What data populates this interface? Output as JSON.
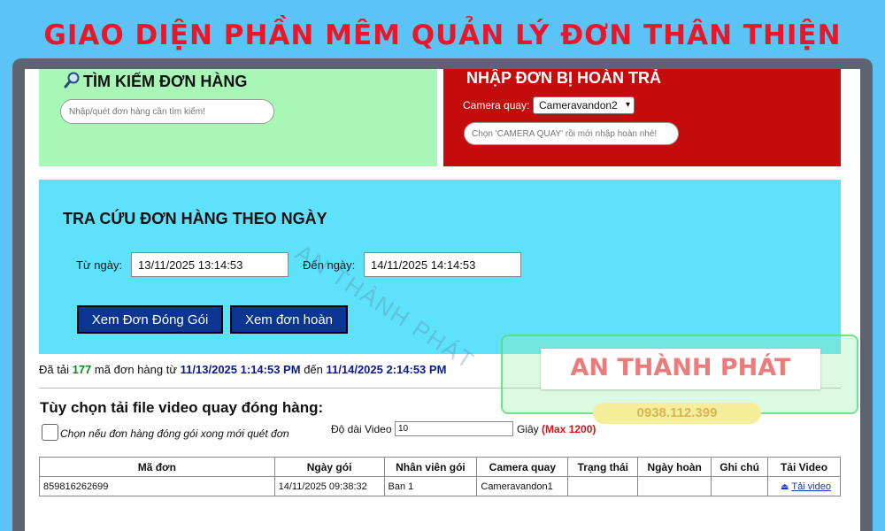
{
  "banner": {
    "title": "GIAO DIỆN PHẦN MÊM QUẢN LÝ ĐƠN THÂN THIỆN"
  },
  "search_panel": {
    "title": "TÌM KIẾM ĐƠN HÀNG",
    "placeholder": "Nhập/quét đơn hàng cần tìm kiếm!",
    "icon": "magnifier-icon"
  },
  "return_panel": {
    "title": "NHẬP ĐƠN BỊ HOÀN TRẢ",
    "camera_label": "Camera quay:",
    "camera_selected": "Cameravandon2",
    "placeholder": "Chọn 'CAMERA QUAY' rồi mới nhập hoàn nhé!"
  },
  "date_panel": {
    "title": "TRA CỨU ĐƠN HÀNG THEO NGÀY",
    "from_label": "Từ ngày:",
    "from_value": "13/11/2025 13:14:53",
    "to_label": "Đến ngày:",
    "to_value": "14/11/2025 14:14:53",
    "btn_pack": "Xem Đơn Đóng Gói",
    "btn_return": "Xem đơn hoàn"
  },
  "status": {
    "prefix": "Đã tải",
    "count": "177",
    "mid": "mã đơn hàng từ",
    "from": "11/13/2025 1:14:53 PM",
    "to_word": "đến",
    "to": "11/14/2025 2:14:53 PM"
  },
  "download_options": {
    "title": "Tùy chọn tải file video quay đóng hàng:",
    "checkbox_label": "Chọn nếu đơn hàng đóng gói xong mới quét đơn",
    "duration_label": "Độ dài Video",
    "duration_value": "10",
    "seconds_label": "Giây",
    "max_label": "(Max 1200)"
  },
  "table": {
    "headers": [
      "Mã đơn",
      "Ngày gói",
      "Nhân viên gói",
      "Camera quay",
      "Trạng thái",
      "Ngày hoàn",
      "Ghi chú",
      "Tải Video"
    ],
    "rows": [
      [
        "859816262699",
        "14/11/2025 09:38:32",
        "Ban 1",
        "Cameravandon1",
        "",
        "",
        "",
        "Tải video"
      ]
    ]
  },
  "watermark": {
    "text": "AN THÀNH PHÁT",
    "logo_text": "AN THÀNH PHÁT",
    "phone": "0938.112.399"
  },
  "colors": {
    "banner_red": "#e8182a",
    "search_panel": "#a8f7b7",
    "return_panel": "#c40c0c",
    "date_panel": "#5ee1fb",
    "button": "#0a3593"
  }
}
